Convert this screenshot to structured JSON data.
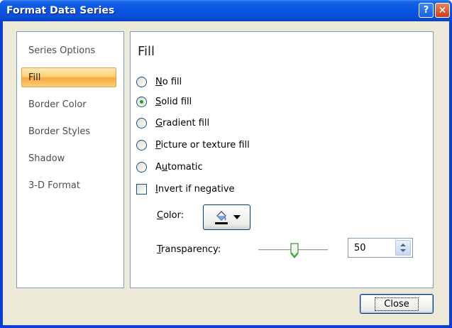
{
  "window": {
    "title": "Format Data Series",
    "help_glyph": "?",
    "close_glyph": "✕"
  },
  "sidebar": {
    "items": [
      {
        "label": "Series Options",
        "selected": false
      },
      {
        "label": "Fill",
        "selected": true
      },
      {
        "label": "Border Color",
        "selected": false
      },
      {
        "label": "Border Styles",
        "selected": false
      },
      {
        "label": "Shadow",
        "selected": false
      },
      {
        "label": "3-D Format",
        "selected": false
      }
    ]
  },
  "main": {
    "section_title": "Fill",
    "options": [
      {
        "label": "No fill",
        "checked": false
      },
      {
        "label": "Solid fill",
        "checked": true
      },
      {
        "label": "Gradient fill",
        "checked": false
      },
      {
        "label": "Picture or texture fill",
        "checked": false
      },
      {
        "label": "Automatic",
        "checked": false
      }
    ],
    "invert_label": "Invert if negative",
    "invert_checked": false,
    "color_label": "Color:",
    "transparency_label": "Transparency:",
    "transparency_value": "50",
    "transparency_fraction": 0.5
  },
  "footer": {
    "close_label": "Close"
  },
  "colors": {
    "title_bar": "#0a4fd8",
    "selected_item": "#fbcf75",
    "radio_dot": "#21a121"
  },
  "icons": [
    "help-icon",
    "close-icon",
    "paint-bucket-icon",
    "dropdown-arrow-icon",
    "slider-thumb-icon",
    "spin-up-icon",
    "spin-down-icon"
  ]
}
